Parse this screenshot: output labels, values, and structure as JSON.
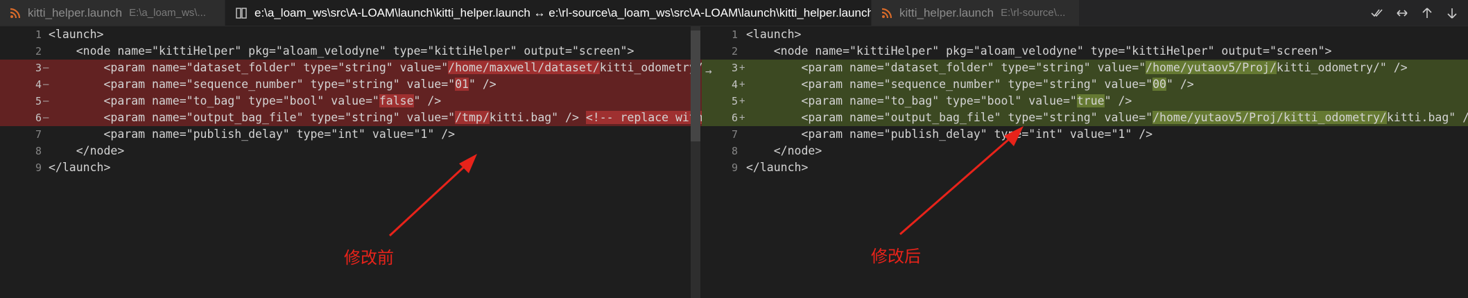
{
  "tabs": [
    {
      "name": "kitti_helper.launch",
      "path": "E:\\a_loam_ws\\...",
      "active": false
    },
    {
      "name": "e:\\a_loam_ws\\src\\A-LOAM\\launch\\kitti_helper.launch ↔ e:\\rl-source\\a_loam_ws\\src\\A-LOAM\\launch\\kitti_helper.launch •",
      "active": true,
      "close": "✕"
    },
    {
      "name": "kitti_helper.launch",
      "path": "E:\\rl-source\\...",
      "active": false
    }
  ],
  "toolbar": {
    "icons": [
      "accept-all-icon",
      "swap-icon",
      "arrow-up-icon",
      "arrow-down-icon"
    ]
  },
  "left": {
    "lines": [
      {
        "num": "1",
        "mark": "",
        "type": "",
        "code": "<launch>"
      },
      {
        "num": "2",
        "mark": "",
        "type": "",
        "code": "    <node name=\"kittiHelper\" pkg=\"aloam_velodyne\" type=\"kittiHelper\" output=\"screen\">"
      },
      {
        "num": "3",
        "mark": "—",
        "type": "del",
        "pre": "        <param name=\"dataset_folder\" type=\"string\" value=\"",
        "hl": "/home/maxwell/dataset/",
        "post": "kitti_odometry/\" /"
      },
      {
        "num": "4",
        "mark": "—",
        "type": "del",
        "pre": "        <param name=\"sequence_number\" type=\"string\" value=\"",
        "hl": "01",
        "post": "\" />"
      },
      {
        "num": "5",
        "mark": "—",
        "type": "del",
        "pre": "        <param name=\"to_bag\" type=\"bool\" value=\"",
        "hl": "false",
        "post": "\" />"
      },
      {
        "num": "6",
        "mark": "—",
        "type": "del",
        "pre": "        <param name=\"output_bag_file\" type=\"string\" value=\"",
        "hl": "/tmp/",
        "post": "kitti.bag\" /> ",
        "hl2": "<!-- replace with yo"
      },
      {
        "num": "7",
        "mark": "",
        "type": "",
        "code": "        <param name=\"publish_delay\" type=\"int\" value=\"1\" />"
      },
      {
        "num": "8",
        "mark": "",
        "type": "",
        "code": "    </node>"
      },
      {
        "num": "9",
        "mark": "",
        "type": "",
        "code": "</launch>"
      }
    ]
  },
  "right": {
    "lines": [
      {
        "num": "1",
        "mark": "",
        "type": "",
        "code": "<launch>"
      },
      {
        "num": "2",
        "mark": "",
        "type": "",
        "code": "    <node name=\"kittiHelper\" pkg=\"aloam_velodyne\" type=\"kittiHelper\" output=\"screen\">"
      },
      {
        "num": "3",
        "mark": "+",
        "type": "ins",
        "pre": "        <param name=\"dataset_folder\" type=\"string\" value=\"",
        "hl": "/home/yutaov5/Proj/",
        "post": "kitti_odometry/\" />"
      },
      {
        "num": "4",
        "mark": "+",
        "type": "ins",
        "pre": "        <param name=\"sequence_number\" type=\"string\" value=\"",
        "hl": "00",
        "post": "\" />"
      },
      {
        "num": "5",
        "mark": "+",
        "type": "ins",
        "pre": "        <param name=\"to_bag\" type=\"bool\" value=\"",
        "hl": "true",
        "post": "\" />"
      },
      {
        "num": "6",
        "mark": "+",
        "type": "ins",
        "pre": "        <param name=\"output_bag_file\" type=\"string\" value=\"",
        "hl": "/home/yutaov5/Proj/kitti_odometry/",
        "post": "kitti.bag\" />"
      },
      {
        "num": "7",
        "mark": "",
        "type": "",
        "code": "        <param name=\"publish_delay\" type=\"int\" value=\"1\" />"
      },
      {
        "num": "8",
        "mark": "",
        "type": "",
        "code": "    </node>"
      },
      {
        "num": "9",
        "mark": "",
        "type": "",
        "code": "</launch>"
      }
    ]
  },
  "annotations": {
    "before": "修改前",
    "after": "修改后",
    "arrow_color": "#e8231a"
  },
  "colors": {
    "del_bg": "#7a2626",
    "ins_bg": "#4b5e22",
    "rss": "#d86b2a"
  }
}
